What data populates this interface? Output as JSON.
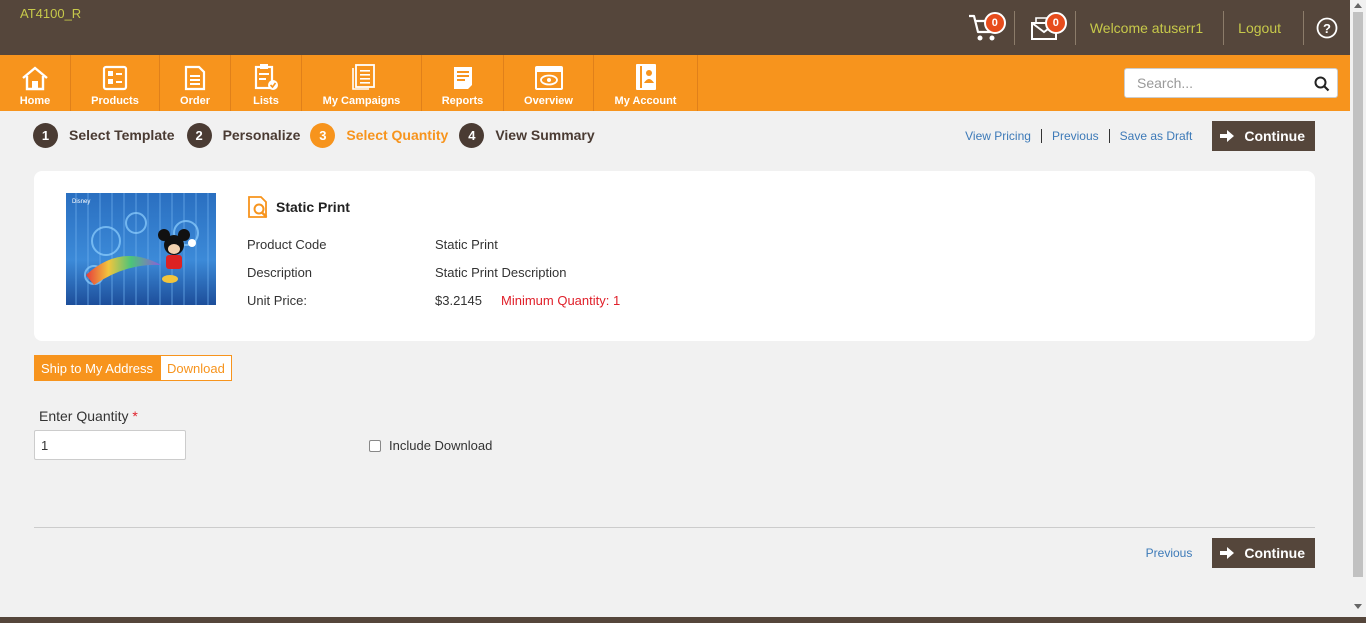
{
  "header": {
    "site_id": "AT4100_R",
    "cart_count": "0",
    "messages_count": "0",
    "welcome": "Welcome atuserr1",
    "logout": "Logout",
    "colors": {
      "topbar": "#55463b",
      "accent": "#f7941d",
      "header_text": "#c7c94a",
      "badge": "#e74c1c"
    }
  },
  "nav": {
    "items": [
      {
        "label": "Home",
        "icon": "home-icon"
      },
      {
        "label": "Products",
        "icon": "products-icon"
      },
      {
        "label": "Order",
        "icon": "order-icon"
      },
      {
        "label": "Lists",
        "icon": "lists-icon"
      },
      {
        "label": "My Campaigns",
        "icon": "campaigns-icon"
      },
      {
        "label": "Reports",
        "icon": "reports-icon"
      },
      {
        "label": "Overview",
        "icon": "overview-icon"
      },
      {
        "label": "My Account",
        "icon": "account-icon"
      }
    ],
    "search_placeholder": "Search..."
  },
  "steps": [
    {
      "num": "1",
      "label": "Select Template"
    },
    {
      "num": "2",
      "label": "Personalize"
    },
    {
      "num": "3",
      "label": "Select Quantity"
    },
    {
      "num": "4",
      "label": "View Summary"
    }
  ],
  "active_step": "3",
  "actions": {
    "view_pricing": "View Pricing",
    "previous": "Previous",
    "save_draft": "Save as Draft",
    "continue": "Continue"
  },
  "product": {
    "title": "Static Print",
    "code_label": "Product Code",
    "code_value": "Static Print",
    "desc_label": "Description",
    "desc_value": "Static Print Description",
    "price_label": "Unit Price:",
    "price_value": "$3.2145",
    "min_qty": "Minimum Quantity: 1"
  },
  "tabs": {
    "ship": "Ship to My Address",
    "download": "Download"
  },
  "quantity": {
    "label": "Enter Quantity",
    "required_mark": "*",
    "value": "1",
    "include_download": "Include Download"
  },
  "bottom": {
    "previous": "Previous",
    "continue": "Continue"
  }
}
